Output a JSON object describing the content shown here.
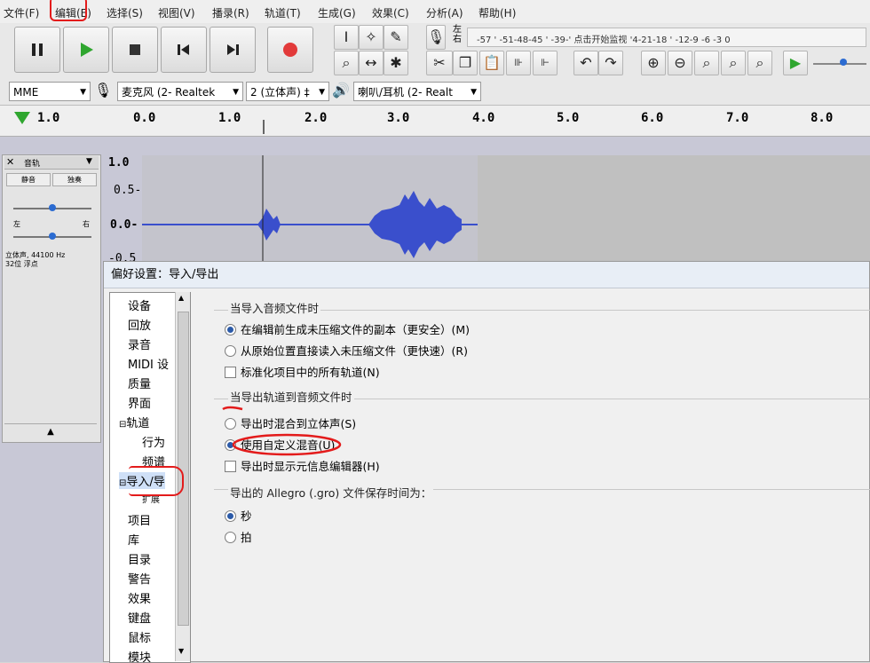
{
  "menu": [
    "文件(F)",
    "编辑(E)",
    "选择(S)",
    "视图(V)",
    "播录(R)",
    "轨道(T)",
    "生成(G)",
    "效果(C)",
    "分析(A)",
    "帮助(H)"
  ],
  "meter": {
    "lr_top": "左",
    "lr_bottom": "右",
    "scale_text": "-57 ' -51-48-45 ' -39-' 点击开始监视 '4-21-18 ' -12-9 -6 -3 0"
  },
  "device": {
    "host": "MME",
    "mic": "麦克风 (2- Realtek",
    "channels": "2 (立体声) ‡",
    "speaker": "喇叭/耳机 (2- Realt"
  },
  "ruler": [
    "1.0",
    "0.0",
    "1.0",
    "2.0",
    "3.0",
    "4.0",
    "5.0",
    "6.0",
    "7.0",
    "8.0"
  ],
  "track": {
    "name": "音轨",
    "mute": "静音",
    "solo": "独奏",
    "pan_left": "左",
    "pan_right": "右",
    "info_line1": "立体声, 44100 Hz",
    "info_line2": "32位 浮点",
    "scale": [
      "1.0",
      "0.5-",
      "0.0-",
      "-0.5"
    ]
  },
  "dialog": {
    "title": "偏好设置：导入/导出",
    "tree": [
      "设备",
      "回放",
      "录音",
      "MIDI 设",
      "质量",
      "界面",
      "轨道",
      "行为",
      "频谱",
      "导入/导",
      "扩展",
      "项目",
      "库",
      "目录",
      "警告",
      "效果",
      "键盘",
      "鼠标",
      "模块"
    ],
    "group1_title": "当导入音频文件时",
    "g1_opt1": "在编辑前生成未压缩文件的副本（更安全）(M)",
    "g1_opt2": "从原始位置直接读入未压缩文件（更快速）(R)",
    "g1_opt3": "标准化项目中的所有轨道(N)",
    "group2_title": "当导出轨道到音频文件时",
    "g2_opt1": "导出时混合到立体声(S)",
    "g2_opt2": "使用自定义混音(U)",
    "g2_opt3": "导出时显示元信息编辑器(H)",
    "group3_title": "导出的 Allegro (.gro) 文件保存时间为：",
    "g3_opt1": "秒",
    "g3_opt2": "拍"
  },
  "colors": {
    "annotation": "#e31b1b",
    "waveform": "#3a4fcc",
    "selected_radio": "#2b5aa8"
  }
}
